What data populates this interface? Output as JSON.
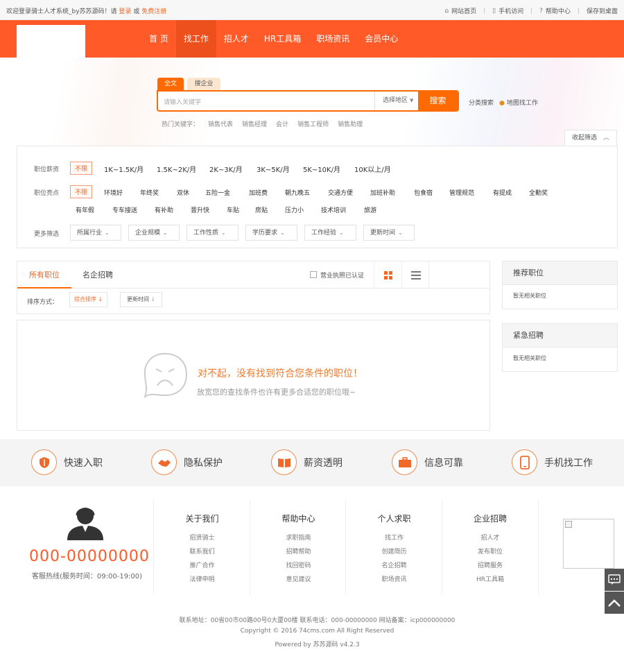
{
  "topbar": {
    "welcome_prefix": "欢迎登录骑士人才系统_by苏苏源码！请",
    "login": "登录",
    "or": "或",
    "register": "免费注册",
    "links": [
      "网站首页",
      "手机访问",
      "帮助中心",
      "保存到桌面"
    ]
  },
  "nav": {
    "items": [
      "首 页",
      "找工作",
      "招人才",
      "HR工具箱",
      "职场资讯",
      "会员中心"
    ],
    "active_index": 1,
    "brand_color": "#ff5a27"
  },
  "search": {
    "tabs": [
      "全文",
      "搜企业"
    ],
    "placeholder": "请输入关键字",
    "area": "选择地区",
    "button": "搜索",
    "category_search": "分类搜索",
    "map_search": "地图找工作",
    "hot_label": "热门关键字：",
    "hot_keywords": [
      "销售代表",
      "销售经理",
      "会计",
      "销售工程师",
      "销售助理"
    ]
  },
  "filters": {
    "collapse": "收起筛选",
    "salary_label": "职位薪资",
    "salary_options": [
      "不限",
      "1K~1.5K/月",
      "1.5K~2K/月",
      "2K~3K/月",
      "3K~5K/月",
      "5K~10K/月",
      "10K以上/月"
    ],
    "highlight_label": "职位亮点",
    "highlight_options": [
      "不限",
      "环境好",
      "年终奖",
      "双休",
      "五险一金",
      "加班费",
      "朝九晚五",
      "交通方便",
      "加班补助",
      "包食宿",
      "管理规范",
      "有提成",
      "全勤奖",
      "有年假",
      "专车接送",
      "有补助",
      "晋升快",
      "车贴",
      "房贴",
      "压力小",
      "技术培训",
      "旅游"
    ],
    "more_label": "更多筛选",
    "more_options": [
      "所属行业",
      "企业规模",
      "工作性质",
      "学历要求",
      "工作经验",
      "更新时间"
    ]
  },
  "results": {
    "tabs": [
      "所有职位",
      "名企招聘"
    ],
    "cert_filter": "营业执照已认证",
    "sort_label": "排序方式：",
    "sort_options": [
      "综合排序",
      "更新时间"
    ],
    "empty_title": "对不起，没有找到符合您条件的职位！",
    "empty_hint": "放宽您的查找条件也许有更多合适您的职位哦~"
  },
  "sidebar": {
    "recommended_title": "推荐职位",
    "recommended_empty": "暂无相关职位",
    "urgent_title": "紧急招聘",
    "urgent_empty": "暂无相关职位"
  },
  "features": [
    "快速入职",
    "隐私保护",
    "薪资透明",
    "信息可靠",
    "手机找工作"
  ],
  "footer": {
    "hotline": "000-00000000",
    "hours": "客服热线(服务时间：09:00-19:00)",
    "columns": [
      {
        "title": "关于我们",
        "links": [
          "招贤骑士",
          "联系我们",
          "推广合作",
          "法律申明"
        ]
      },
      {
        "title": "帮助中心",
        "links": [
          "求职指南",
          "招聘帮助",
          "找回密码",
          "意见建议"
        ]
      },
      {
        "title": "个人求职",
        "links": [
          "找工作",
          "创建简历",
          "名企招聘",
          "职场资讯"
        ]
      },
      {
        "title": "企业招聘",
        "links": [
          "招人才",
          "发布职位",
          "招聘服务",
          "HR工具箱"
        ]
      }
    ],
    "address": "联系地址：00省00市00路00号0大厦00楼 联系电话：000-00000000 网站备案：icp000000000",
    "copyright": "Copyright © 2016 74cms.com All Right Reserved",
    "powered": "Powered by 苏苏源码 v4.2.3"
  }
}
